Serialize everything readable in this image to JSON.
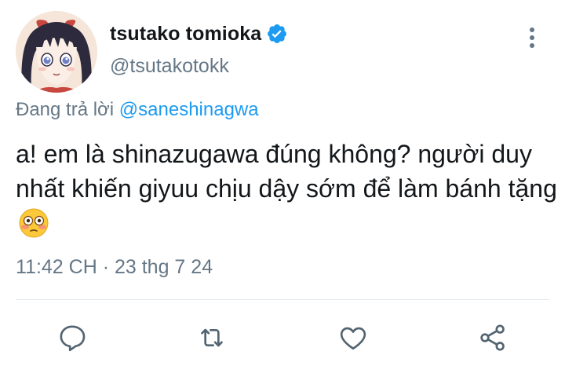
{
  "author": {
    "display_name": "tsutako tomioka",
    "handle": "@tsutakotokk",
    "verified": true,
    "avatar_icon": "anime-avatar"
  },
  "reply": {
    "prefix": "Đang trả lời",
    "mention": "@saneshinagwa"
  },
  "tweet": {
    "text": "a! em là shinazugawa đúng không? người duy nhất khiến giyuu chịu dậy sớm để làm bánh tặng",
    "emoji": "flushed-face-emoji"
  },
  "meta": {
    "time": "11:42 CH",
    "separator": " · ",
    "date": "23 thg 7 24"
  },
  "actions": [
    {
      "name": "reply",
      "icon": "speech-bubble-icon"
    },
    {
      "name": "retweet",
      "icon": "retweet-icon"
    },
    {
      "name": "like",
      "icon": "heart-icon"
    },
    {
      "name": "share",
      "icon": "share-icon"
    }
  ],
  "colors": {
    "verified_blue": "#1d9bf0",
    "mention_blue": "#1d9bf0",
    "secondary_text": "#657786",
    "icon_gray": "#536471"
  }
}
